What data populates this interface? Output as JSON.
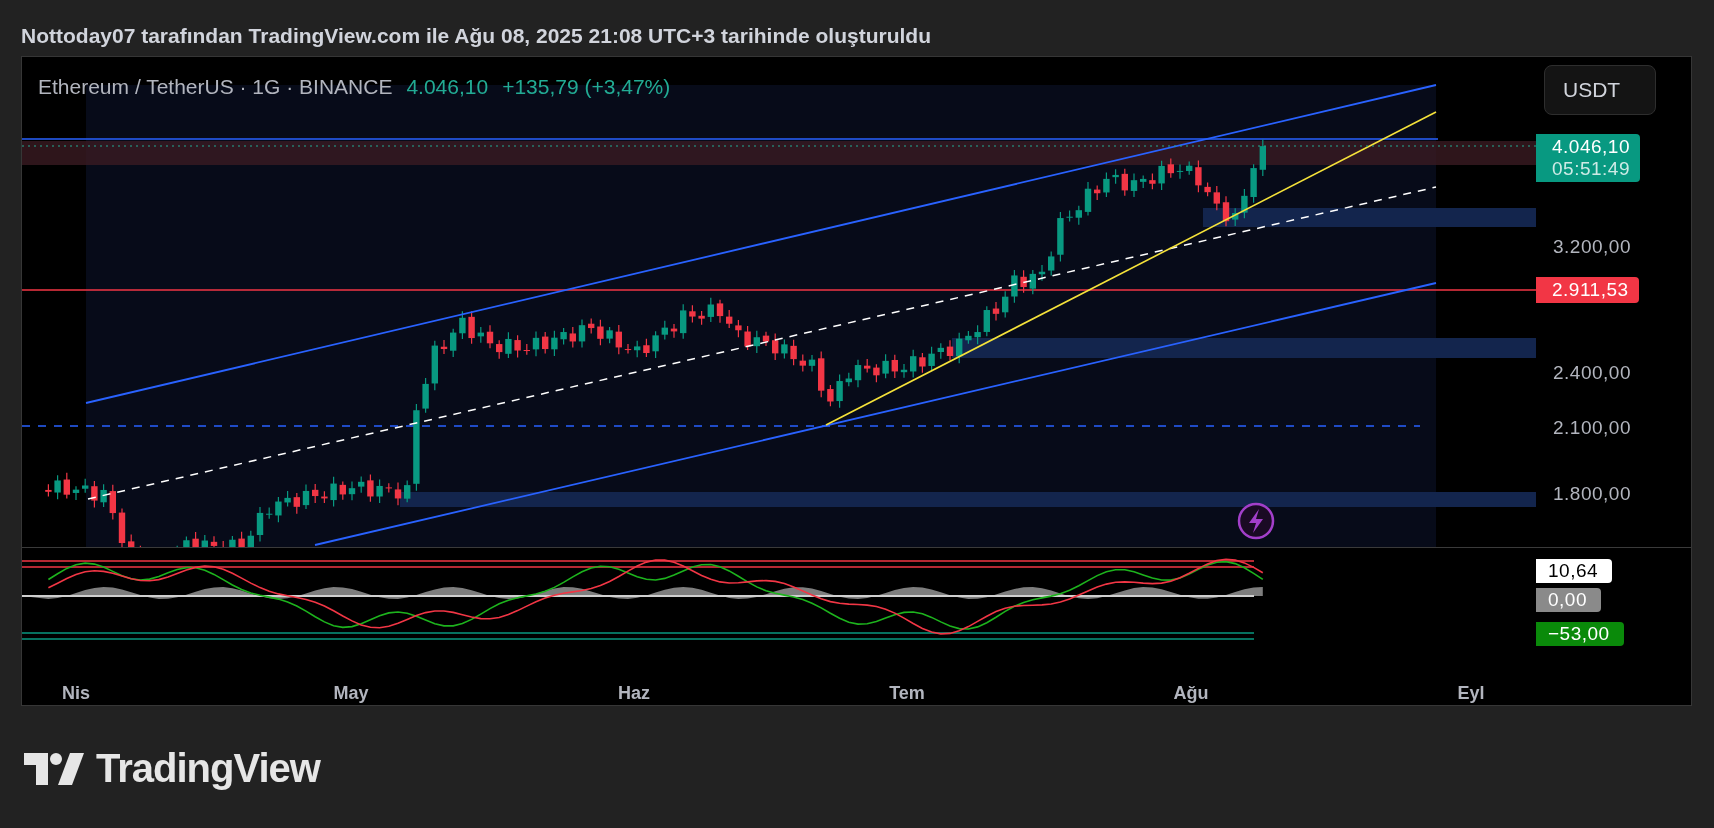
{
  "header": {
    "title": "Nottoday07 tarafından TradingView.com ile Ağu 08, 2025 21:08 UTC+3 tarihinde oluşturuldu"
  },
  "legend": {
    "symbol": "Ethereum / TetherUS · 1G · BINANCE",
    "price": "4.046,10",
    "change": "+135,79 (+3,47%)"
  },
  "currency_button": "USDT",
  "price_axis": [
    "3.200,00",
    "2.400,00",
    "2.100,00",
    "1.800,00"
  ],
  "price_badges": [
    {
      "kind": "last",
      "value": "4.046,10",
      "countdown": "05:51:49"
    },
    {
      "kind": "level",
      "value": "2.911,53"
    }
  ],
  "oscillator_labels": [
    {
      "kind": "value",
      "text": "10,64"
    },
    {
      "kind": "zero",
      "text": "0,00"
    },
    {
      "kind": "low",
      "text": "−53,00"
    }
  ],
  "time_axis": [
    "Nis",
    "May",
    "Haz",
    "Tem",
    "Ağu",
    "Eyl"
  ],
  "branding": {
    "logo_text": "TradingView"
  }
}
